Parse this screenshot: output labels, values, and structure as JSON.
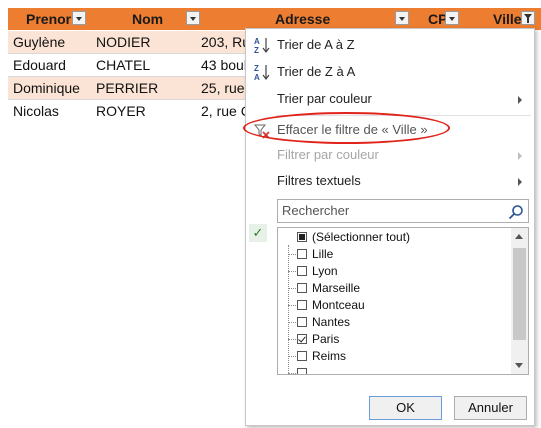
{
  "sheet": {
    "headers": [
      {
        "label": "Prenor",
        "filter": "dropdown"
      },
      {
        "label": "Nom",
        "filter": "dropdown"
      },
      {
        "label": "Adresse",
        "filter": "dropdown"
      },
      {
        "label": "CP",
        "filter": "dropdown"
      },
      {
        "label": "Ville",
        "filter": "filtered"
      }
    ],
    "rows": [
      {
        "prenom": "Guylène",
        "nom": "NODIER",
        "adresse": "203, Ru"
      },
      {
        "prenom": "Edouard",
        "nom": "CHATEL",
        "adresse": "43 boul"
      },
      {
        "prenom": "Dominique",
        "nom": "PERRIER",
        "adresse": "25, rue"
      },
      {
        "prenom": "Nicolas",
        "nom": "ROYER",
        "adresse": "2, rue C"
      }
    ],
    "colors": {
      "header": "#ED7D31",
      "band": "#FBE4D5"
    }
  },
  "menu": {
    "sort_az_label": "Trier de A à Z",
    "sort_za_label": "Trier de Z à A",
    "sort_color_label": "Trier par couleur",
    "clear_filter_label": "Effacer le filtre de « Ville »",
    "filter_color_label": "Filtrer par couleur",
    "text_filters_label": "Filtres textuels",
    "search_placeholder": "Rechercher",
    "list": [
      {
        "label": "(Sélectionner tout)",
        "state": "partial"
      },
      {
        "label": "Lille",
        "state": "unchecked"
      },
      {
        "label": "Lyon",
        "state": "unchecked"
      },
      {
        "label": "Marseille",
        "state": "unchecked"
      },
      {
        "label": "Montceau",
        "state": "unchecked"
      },
      {
        "label": "Nantes",
        "state": "unchecked"
      },
      {
        "label": "Paris",
        "state": "checked"
      },
      {
        "label": "Reims",
        "state": "unchecked"
      }
    ],
    "ok_label": "OK",
    "cancel_label": "Annuler",
    "highlight_color": "#e0241b"
  }
}
